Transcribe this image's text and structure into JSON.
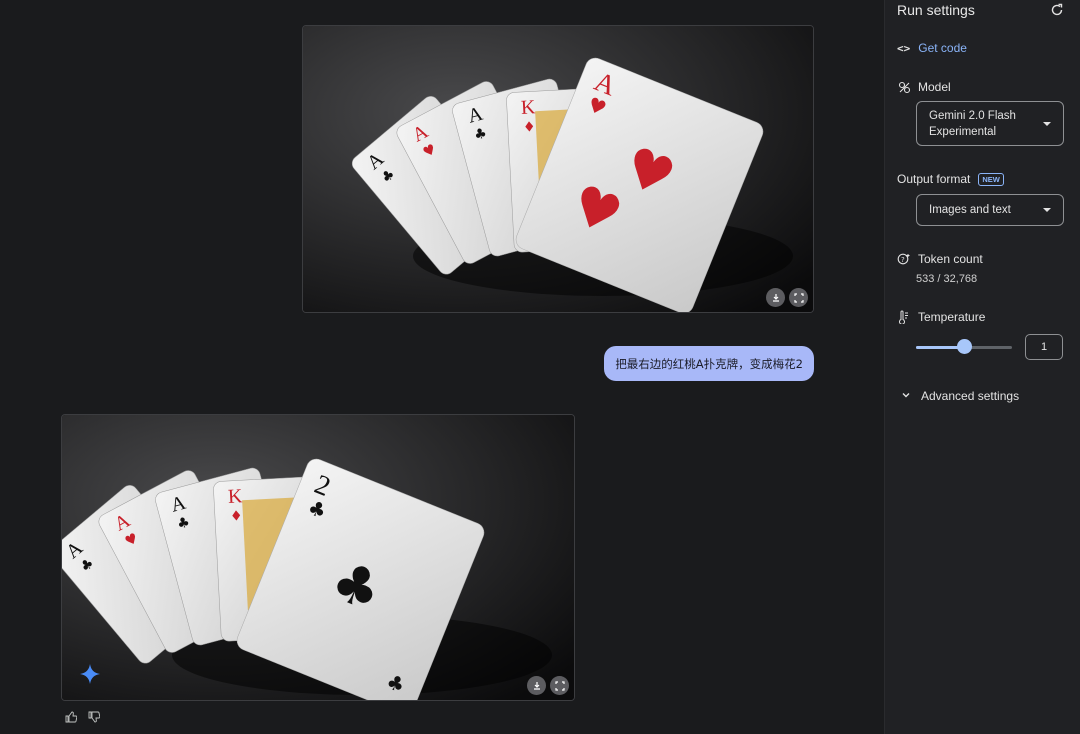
{
  "chat": {
    "user_message": "把最右边的红桃A扑克牌，变成梅花2"
  },
  "sidebar": {
    "title": "Run settings",
    "get_code": "Get code",
    "model": {
      "label": "Model",
      "value_line1": "Gemini 2.0 Flash",
      "value_line2": "Experimental"
    },
    "output_format": {
      "label": "Output format",
      "badge": "NEW",
      "value": "Images and text"
    },
    "token_count": {
      "label": "Token count",
      "value": "533 / 32,768"
    },
    "temperature": {
      "label": "Temperature",
      "value": "1",
      "slider_fraction": 0.5
    },
    "advanced": "Advanced settings"
  },
  "cards": {
    "top": [
      "A",
      "A",
      "A",
      "K",
      "A"
    ],
    "bottom": [
      "A",
      "A",
      "A",
      "K",
      "2"
    ]
  },
  "colors": {
    "accent": "#8ab4f8",
    "bubble": "#a8b8f8",
    "red": "#c8202a",
    "black": "#111111"
  }
}
